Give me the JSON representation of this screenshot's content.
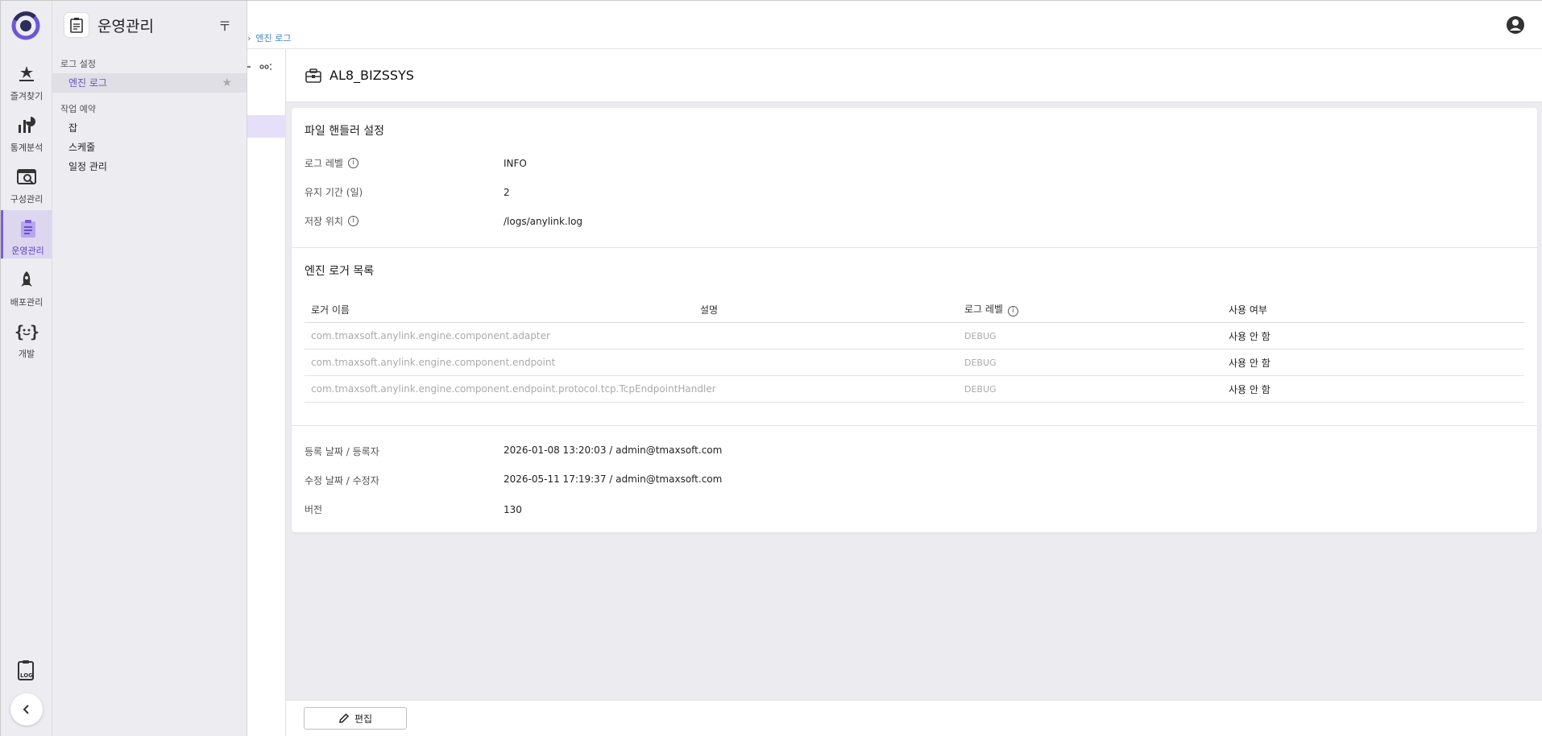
{
  "rail": {
    "items": [
      {
        "label": "즐겨찾기",
        "icon": "star-list-icon"
      },
      {
        "label": "통계분석",
        "icon": "stats-icon"
      },
      {
        "label": "구성관리",
        "icon": "config-icon"
      },
      {
        "label": "운영관리",
        "icon": "clipboard-icon"
      },
      {
        "label": "배포관리",
        "icon": "rocket-icon"
      },
      {
        "label": "개발",
        "icon": "code-icon"
      }
    ],
    "accent": "#7b5cd6"
  },
  "menu": {
    "title": "운영관리",
    "pin": "〒",
    "sections": [
      {
        "title": "로그 설정",
        "items": [
          "엔진 로그"
        ]
      },
      {
        "title": "작업 예약",
        "items": [
          "잡",
          "스케줄",
          "일정 관리"
        ]
      }
    ]
  },
  "breadcrumb": {
    "current": "엔진 로그"
  },
  "detail": {
    "title": "AL8_BIZSSYS",
    "file_handler": {
      "title": "파일 핸들러 설정",
      "log_level_label": "로그 레벨",
      "log_level": "INFO",
      "retention_label": "유지 기간 (일)",
      "retention": "2",
      "location_label": "저장 위치",
      "location": "/logs/anylink.log"
    },
    "loggers": {
      "title": "엔진 로거 목록",
      "columns": [
        "로거 이름",
        "설명",
        "로그 레벨",
        "사용 여부"
      ],
      "rows": [
        {
          "name": "com.tmaxsoft.anylink.engine.component.adapter",
          "desc": "",
          "level": "DEBUG",
          "use": "사용 안 함"
        },
        {
          "name": "com.tmaxsoft.anylink.engine.component.endpoint",
          "desc": "",
          "level": "DEBUG",
          "use": "사용 안 함"
        },
        {
          "name": "com.tmaxsoft.anylink.engine.component.endpoint.protocol.tcp.TcpEndpointHandler",
          "desc": "",
          "level": "DEBUG",
          "use": "사용 안 함"
        }
      ]
    },
    "meta": {
      "created_label": "등록 날짜 / 등록자",
      "created": "2026-01-08 13:20:03 / admin@tmaxsoft.com",
      "modified_label": "수정 날짜 / 수정자",
      "modified": "2026-05-11 17:19:37 / admin@tmaxsoft.com",
      "version_label": "버전",
      "version": "130"
    }
  },
  "actions": {
    "edit": "편집"
  }
}
